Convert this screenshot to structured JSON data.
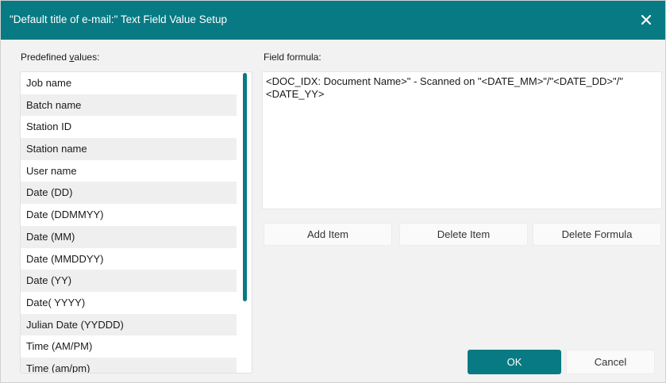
{
  "window": {
    "title": "\"Default title of e-mail:\" Text Field Value Setup",
    "close_icon": "close-icon"
  },
  "predefined": {
    "label_pre": "Predefined ",
    "label_accel": "v",
    "label_post": "alues:",
    "items": [
      {
        "label": "Job name"
      },
      {
        "label": "Batch name"
      },
      {
        "label": "Station ID"
      },
      {
        "label": "Station name"
      },
      {
        "label": "User name"
      },
      {
        "label": "Date (DD)"
      },
      {
        "label": "Date (DDMMYY)"
      },
      {
        "label": "Date (MM)"
      },
      {
        "label": "Date (MMDDYY)"
      },
      {
        "label": "Date (YY)"
      },
      {
        "label": "Date( YYYY)"
      },
      {
        "label": "Julian Date (YYDDD)"
      },
      {
        "label": "Time (AM/PM)"
      },
      {
        "label": "Time (am/pm)"
      }
    ]
  },
  "formula": {
    "label": "Field formula:",
    "value": "<DOC_IDX: Document Name>\" - Scanned on \"<DATE_MM>\"/\"<DATE_DD>\"/\"<DATE_YY>"
  },
  "buttons": {
    "add_item": "Add Item",
    "delete_item": "Delete Item",
    "delete_formula": "Delete Formula",
    "ok": "OK",
    "cancel": "Cancel"
  },
  "colors": {
    "accent": "#087a83",
    "background": "#f2f2f2"
  }
}
